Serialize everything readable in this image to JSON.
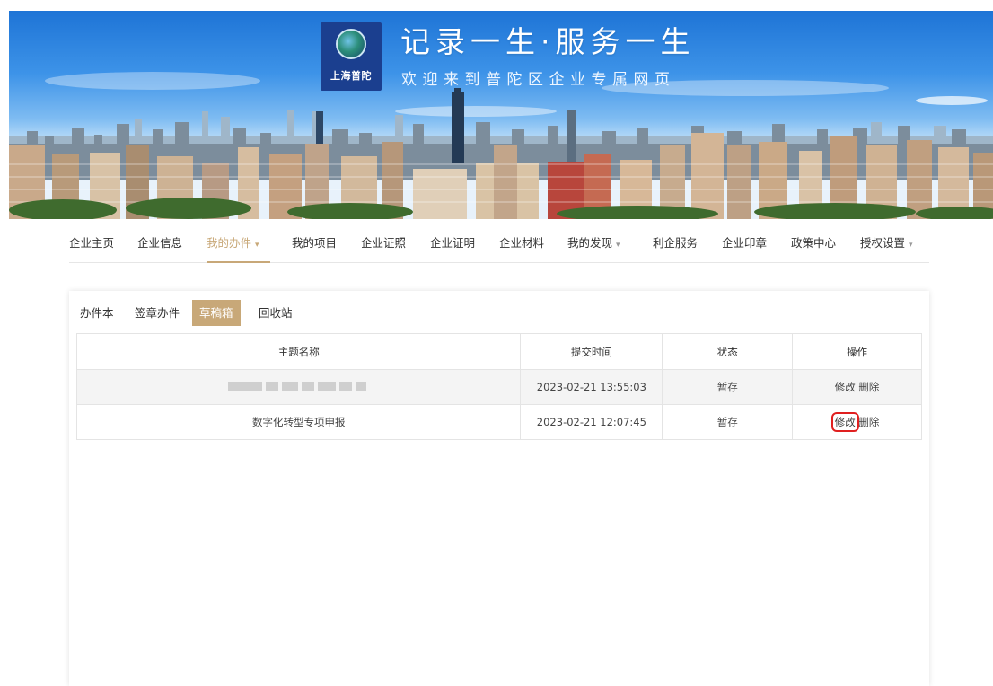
{
  "banner": {
    "logo_text": "上海普陀",
    "slogan": "记录一生·服务一生",
    "subslogan": "欢迎来到普陀区企业专属网页"
  },
  "nav": {
    "items": [
      {
        "label": "企业主页",
        "active": false,
        "dropdown": false
      },
      {
        "label": "企业信息",
        "active": false,
        "dropdown": false
      },
      {
        "label": "我的办件",
        "active": true,
        "dropdown": true
      },
      {
        "label": "我的项目",
        "active": false,
        "dropdown": false
      },
      {
        "label": "企业证照",
        "active": false,
        "dropdown": false
      },
      {
        "label": "企业证明",
        "active": false,
        "dropdown": false
      },
      {
        "label": "企业材料",
        "active": false,
        "dropdown": false
      },
      {
        "label": "我的发现",
        "active": false,
        "dropdown": true
      },
      {
        "label": "利企服务",
        "active": false,
        "dropdown": false
      },
      {
        "label": "企业印章",
        "active": false,
        "dropdown": false
      },
      {
        "label": "政策中心",
        "active": false,
        "dropdown": false
      },
      {
        "label": "授权设置",
        "active": false,
        "dropdown": true
      }
    ],
    "caret": "▾"
  },
  "subtabs": [
    {
      "label": "办件本",
      "active": false
    },
    {
      "label": "签章办件",
      "active": false
    },
    {
      "label": "草稿箱",
      "active": true
    },
    {
      "label": "回收站",
      "active": false
    }
  ],
  "table": {
    "headers": [
      "主题名称",
      "提交时间",
      "状态",
      "操作"
    ],
    "rows": [
      {
        "title": "",
        "title_redacted": true,
        "time": "2023-02-21 13:55:03",
        "status": "暂存",
        "edit": "修改",
        "delete": "删除"
      },
      {
        "title": "数字化转型专项申报",
        "title_redacted": false,
        "time": "2023-02-21 12:07:45",
        "status": "暂存",
        "edit": "修改",
        "delete": "删除"
      }
    ]
  },
  "colors": {
    "accent": "#c8a878",
    "highlight_box": "#e02020",
    "logo_bg": "#1b3f8f"
  }
}
